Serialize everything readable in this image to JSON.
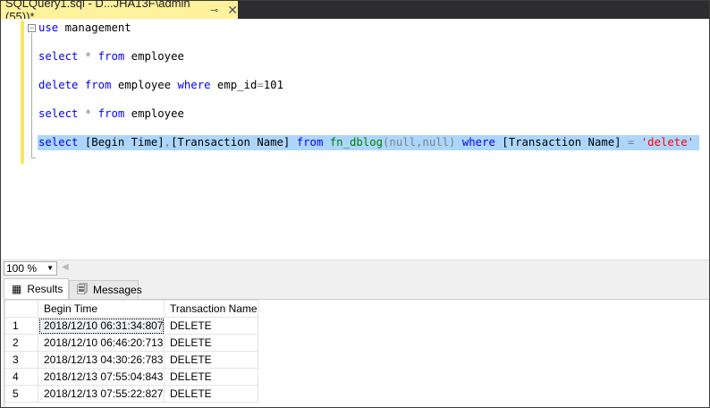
{
  "tab": {
    "title": "SQLQuery1.sql - D...JHA13F\\admin (55))*",
    "pin_icon": "pin-icon",
    "close_icon": "close-icon"
  },
  "editor": {
    "lines": [
      [
        {
          "t": "use",
          "c": "kw"
        },
        {
          "t": " management",
          "c": ""
        }
      ],
      [
        {
          "t": "select",
          "c": "kw"
        },
        {
          "t": " * ",
          "c": "gr"
        },
        {
          "t": "from",
          "c": "kw"
        },
        {
          "t": " employee",
          "c": ""
        }
      ],
      [
        {
          "t": "delete",
          "c": "kw"
        },
        {
          "t": " ",
          "c": ""
        },
        {
          "t": "from",
          "c": "kw"
        },
        {
          "t": " employee ",
          "c": ""
        },
        {
          "t": "where",
          "c": "kw"
        },
        {
          "t": " emp_id",
          "c": ""
        },
        {
          "t": "=",
          "c": "gr"
        },
        {
          "t": "101",
          "c": ""
        }
      ],
      [
        {
          "t": "select",
          "c": "kw"
        },
        {
          "t": " * ",
          "c": "gr"
        },
        {
          "t": "from",
          "c": "kw"
        },
        {
          "t": " employee",
          "c": ""
        }
      ],
      [
        {
          "t": "select",
          "c": "kw"
        },
        {
          "t": " [Begin Time]",
          "c": ""
        },
        {
          "t": ",",
          "c": "gr"
        },
        {
          "t": "[Transaction Name] ",
          "c": ""
        },
        {
          "t": "from",
          "c": "kw"
        },
        {
          "t": " ",
          "c": ""
        },
        {
          "t": "fn_dblog",
          "c": "fn"
        },
        {
          "t": "(null,null)",
          "c": "gr"
        },
        {
          "t": " ",
          "c": ""
        },
        {
          "t": "where",
          "c": "kw"
        },
        {
          "t": " [Transaction Name] ",
          "c": ""
        },
        {
          "t": "=",
          "c": "gr"
        },
        {
          "t": " ",
          "c": ""
        },
        {
          "t": "'delete'",
          "c": "st"
        }
      ]
    ]
  },
  "zoom": {
    "value": "100 %"
  },
  "result_tabs": {
    "results": "Results",
    "messages": "Messages"
  },
  "grid": {
    "columns": [
      "",
      "Begin Time",
      "Transaction Name"
    ],
    "rows": [
      [
        "1",
        "2018/12/10 06:31:34:807",
        "DELETE"
      ],
      [
        "2",
        "2018/12/10 06:46:20:713",
        "DELETE"
      ],
      [
        "3",
        "2018/12/13 04:30:26:783",
        "DELETE"
      ],
      [
        "4",
        "2018/12/13 07:55:04:843",
        "DELETE"
      ],
      [
        "5",
        "2018/12/13 07:55:22:827",
        "DELETE"
      ]
    ]
  },
  "colors": {
    "tab_active": "#fff29d",
    "selection": "#add6ff",
    "keyword": "#0000ff",
    "function": "#008000",
    "string": "#ff0000"
  }
}
